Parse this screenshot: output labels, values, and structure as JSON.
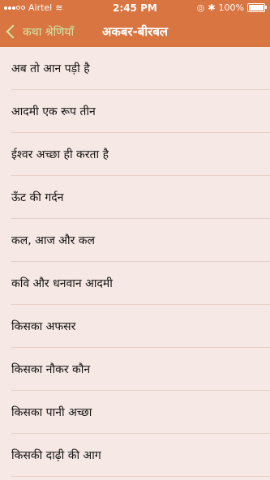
{
  "status_bar": {
    "carrier": "Airtel",
    "time": "2:45 PM",
    "battery": "100%"
  },
  "nav": {
    "back_label": "कथा श्रेणियाँ",
    "title": "अकबर-बीरबल"
  },
  "items": [
    "अब तो आन पड़ी है",
    "आदमी एक रूप तीन",
    "ईश्वर अच्छा ही करता है",
    "ऊँट की गर्दन",
    "कल, आज और कल",
    "कवि और धनवान आदमी",
    "किसका अफसर",
    "किसका नौकर कौन",
    "किसका पानी अच्छा",
    "किसकी दाढ़ी की आग"
  ],
  "colors": {
    "accent": "#d97541",
    "back_text": "#cfe8a8",
    "background": "#f6e8e4"
  }
}
